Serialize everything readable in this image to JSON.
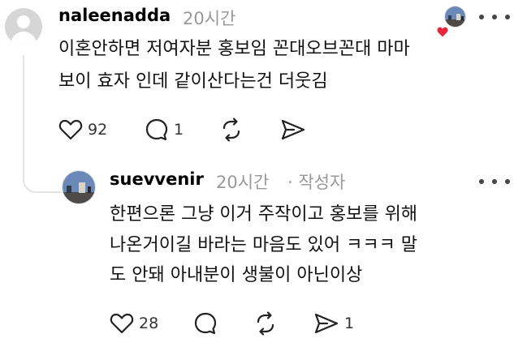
{
  "post": {
    "username": "naleenadda",
    "time": "20시간",
    "lines": [
      "이혼안하면 저여자분 홍보임 꼰대오브꼰대 마마",
      "보이 효자 인데 같이산다는건 더웃김"
    ],
    "likes": "92",
    "replies": "1",
    "liked_by_author_icon": "red-heart-icon",
    "reposts": "",
    "shares": ""
  },
  "reply": {
    "username": "suevvenir",
    "time": "20시간",
    "author_tag": "· 작성자",
    "lines": [
      "한편으론 그냥 이거 주작이고 홍보를 위해",
      "나온거이길 바라는 마음도 있어 ㅋㅋㅋ 말",
      "도 안돼 아내분이 생불이 아닌이상"
    ],
    "likes": "28",
    "replies": "",
    "reposts": "",
    "shares": "1"
  },
  "colors": {
    "heart": "#e8253d",
    "muted": "#999999",
    "thread_line": "#e4e4e4"
  }
}
